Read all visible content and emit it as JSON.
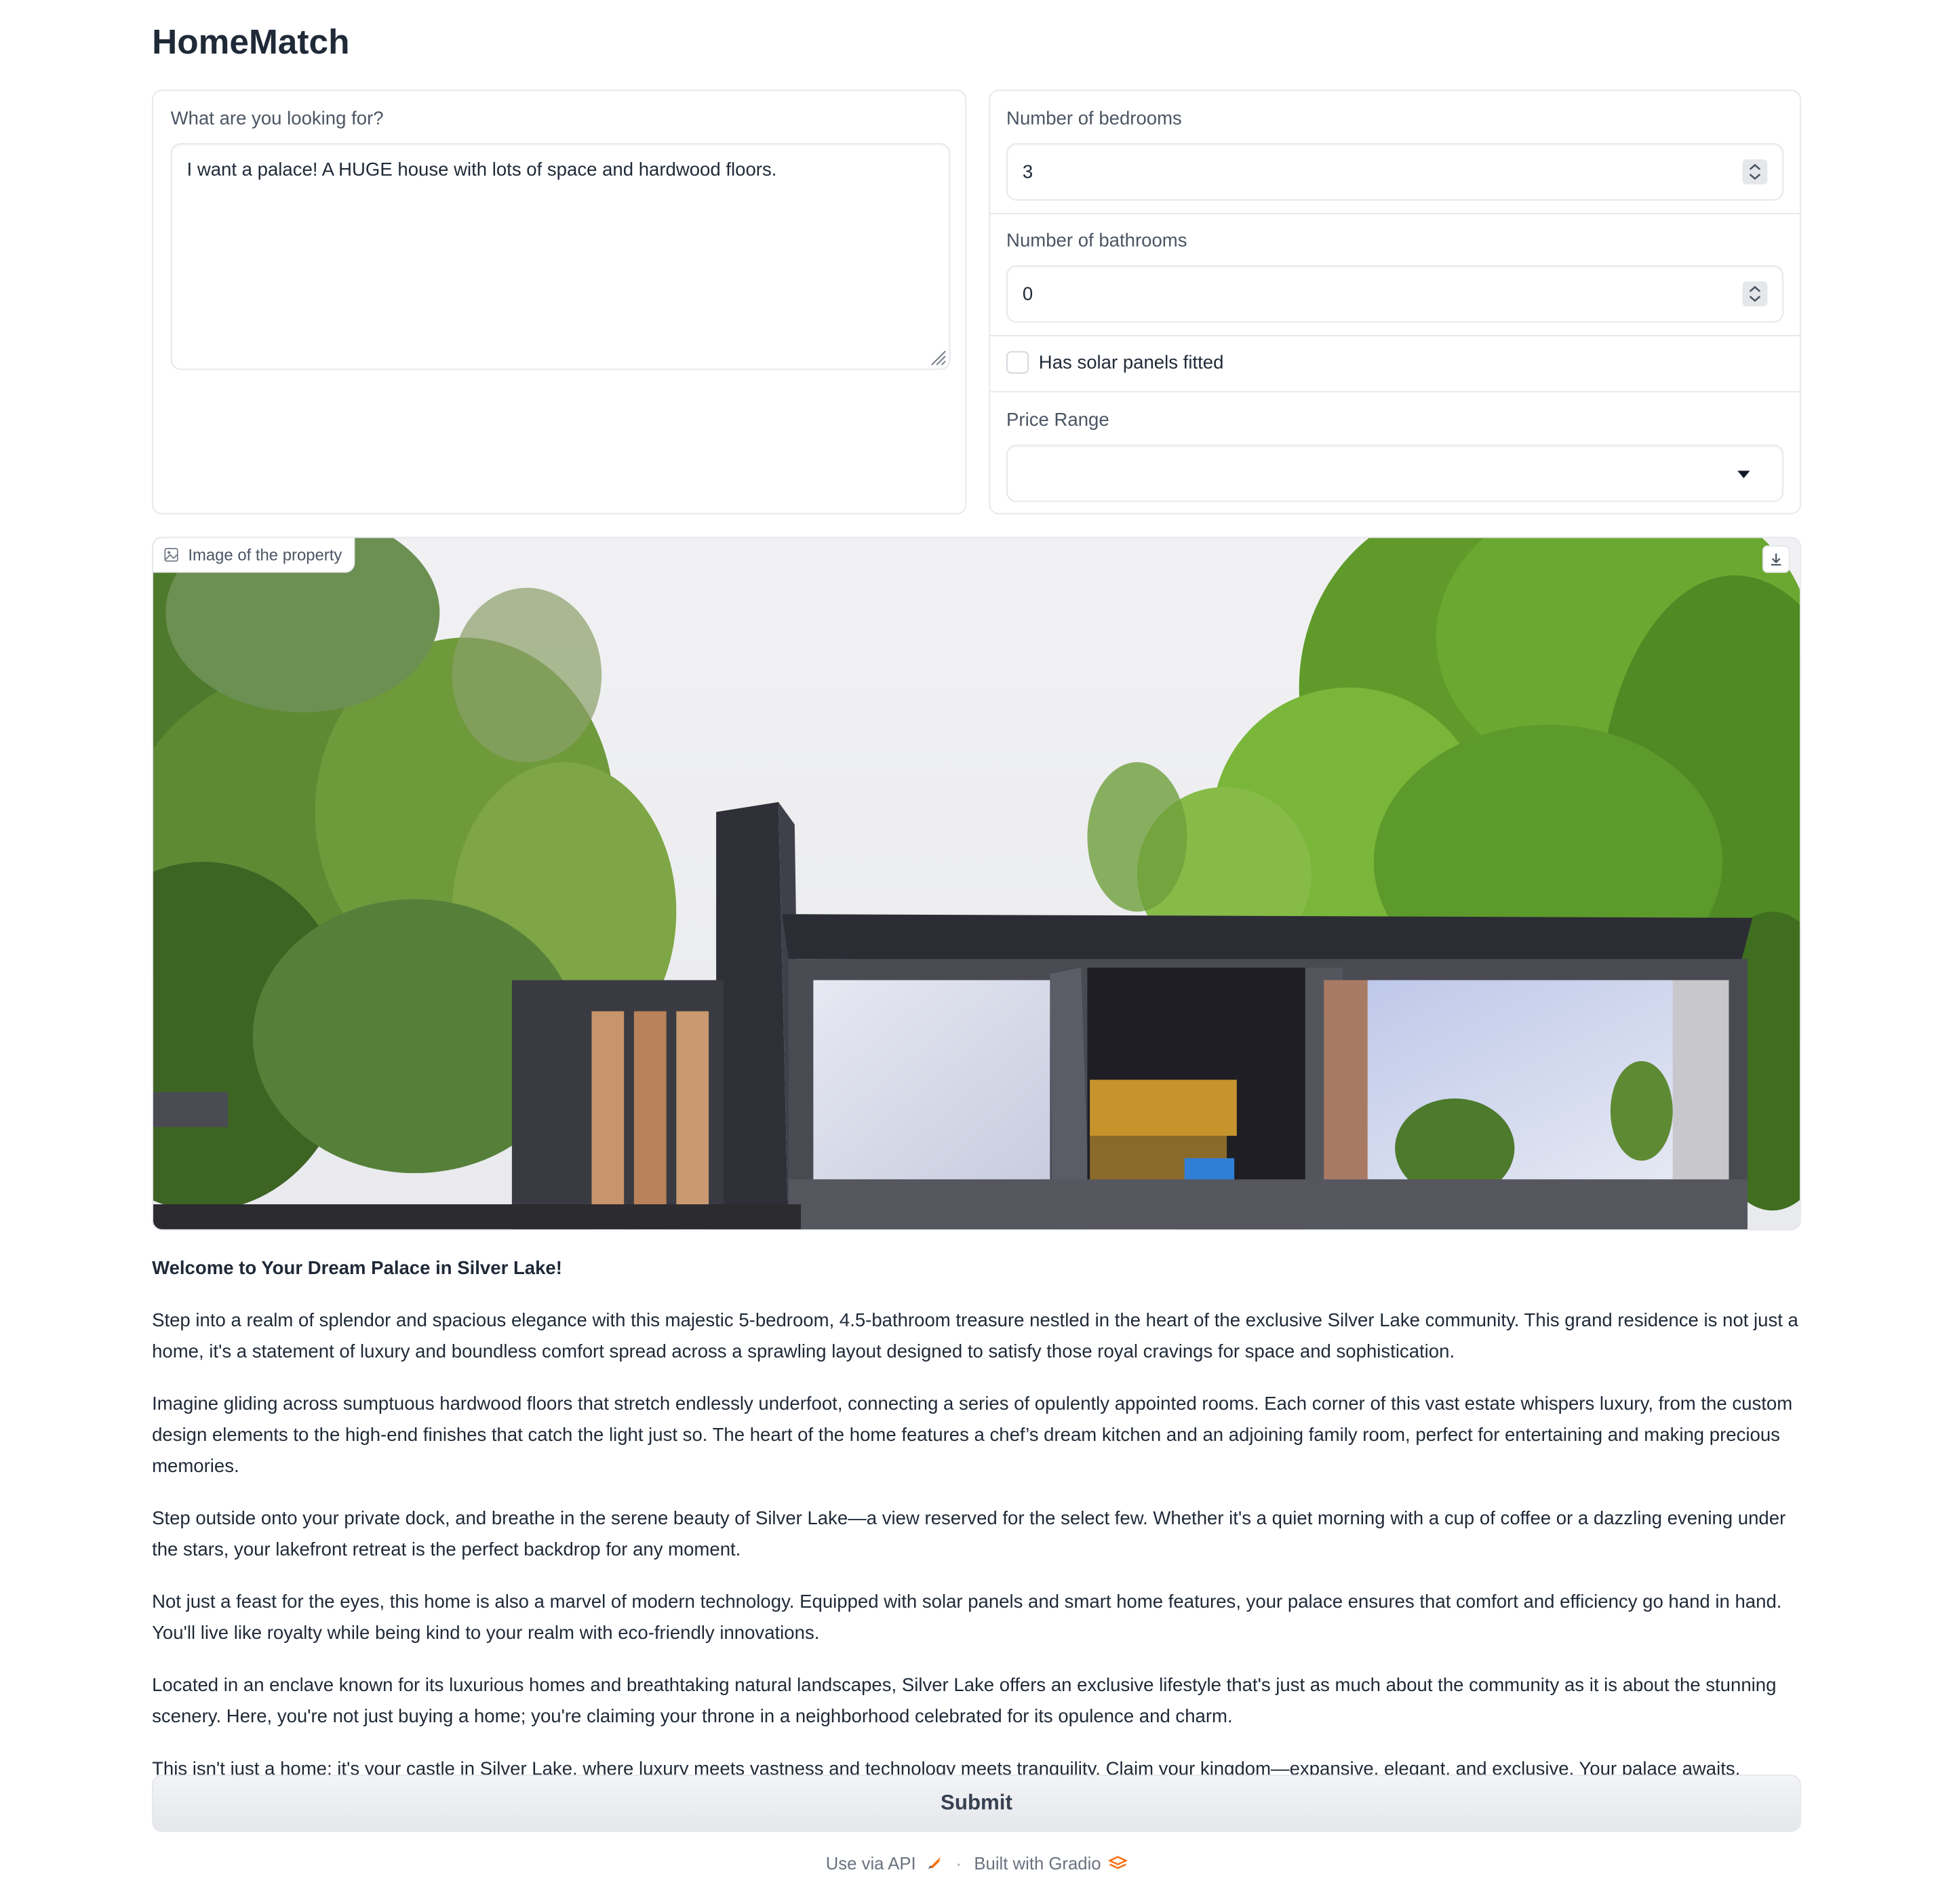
{
  "app": {
    "title": "HomeMatch"
  },
  "query": {
    "label": "What are you looking for?",
    "value": "I want a palace! A HUGE house with lots of space and hardwood floors."
  },
  "filters": {
    "bedrooms_label": "Number of bedrooms",
    "bedrooms_value": "3",
    "bathrooms_label": "Number of bathrooms",
    "bathrooms_value": "0",
    "solar_label": "Has solar panels fitted",
    "solar_checked": false,
    "price_label": "Price Range",
    "price_value": ""
  },
  "image": {
    "label": "Image of the property",
    "icon": "image-icon",
    "download_icon": "download-icon"
  },
  "description": {
    "heading": "Welcome to Your Dream Palace in Silver Lake!",
    "paragraphs": [
      "Step into a realm of splendor and spacious elegance with this majestic 5-bedroom, 4.5-bathroom treasure nestled in the heart of the exclusive Silver Lake community. This grand residence is not just a home, it's a statement of luxury and boundless comfort spread across a sprawling layout designed to satisfy those royal cravings for space and sophistication.",
      "Imagine gliding across sumptuous hardwood floors that stretch endlessly underfoot, connecting a series of opulently appointed rooms. Each corner of this vast estate whispers luxury, from the custom design elements to the high-end finishes that catch the light just so. The heart of the home features a chef’s dream kitchen and an adjoining family room, perfect for entertaining and making precious memories.",
      "Step outside onto your private dock, and breathe in the serene beauty of Silver Lake—a view reserved for the select few. Whether it's a quiet morning with a cup of coffee or a dazzling evening under the stars, your lakefront retreat is the perfect backdrop for any moment.",
      "Not just a feast for the eyes, this home is also a marvel of modern technology. Equipped with solar panels and smart home features, your palace ensures that comfort and efficiency go hand in hand. You'll live like royalty while being kind to your realm with eco-friendly innovations.",
      "Located in an enclave known for its luxurious homes and breathtaking natural landscapes, Silver Lake offers an exclusive lifestyle that's just as much about the community as it is about the stunning scenery. Here, you're not just buying a home; you're claiming your throne in a neighborhood celebrated for its opulence and charm.",
      "This isn't just a home; it's your castle in Silver Lake, where luxury meets vastness and technology meets tranquility. Claim your kingdom—expansive, elegant, and exclusive. Your palace awaits."
    ]
  },
  "actions": {
    "submit_label": "Submit"
  },
  "footer": {
    "api_label": "Use via API",
    "separator": "·",
    "built_label": "Built with Gradio"
  },
  "colors": {
    "border": "#e5e7eb",
    "text": "#1f2937",
    "muted": "#4b5563",
    "gradio_orange": "#f97316"
  }
}
